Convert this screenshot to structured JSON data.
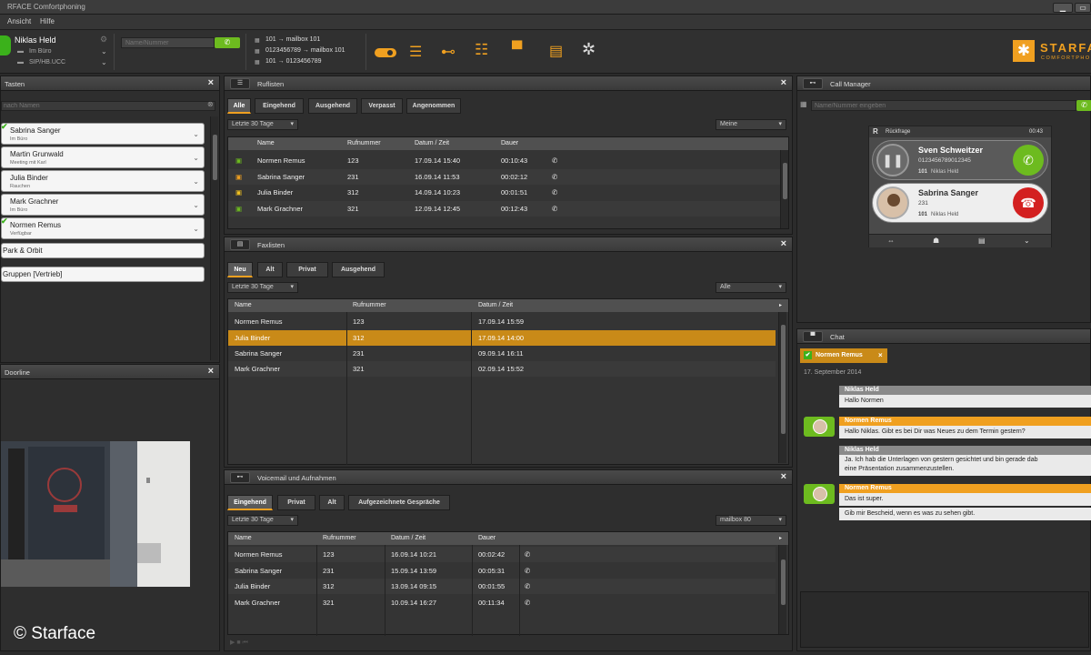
{
  "window": {
    "title": "RFACE Comfortphoning",
    "min": "▁",
    "max": "▭"
  },
  "menu": {
    "items": [
      "Ansicht",
      "Hilfe"
    ]
  },
  "user": {
    "name": "Niklas Held",
    "status": "Im Büro",
    "device": "SIP/HB.UCC"
  },
  "dial": {
    "placeholder": "Name/Nummer"
  },
  "forwards": [
    "101 → mailbox 101",
    "0123456789 → mailbox 101",
    "101 → 0123456789"
  ],
  "brand": {
    "name": "STARFA",
    "sub": "COMFORTPHO"
  },
  "tasten": {
    "title": "Tasten",
    "search_placeholder": "nach Namen",
    "keys": [
      {
        "name": "Sabrina Sanger",
        "sub": "Im Büro",
        "check": true
      },
      {
        "name": "Martin Grunwald",
        "sub": "Meeting mit Karl",
        "check": false
      },
      {
        "name": "Julia Binder",
        "sub": "Rauchen",
        "check": false
      },
      {
        "name": "Mark Grachner",
        "sub": "Im Büro",
        "check": false
      },
      {
        "name": "Normen Remus",
        "sub": "Verfügbar",
        "check": true
      }
    ],
    "groups": [
      "Park & Orbit",
      "Gruppen [Vertrieb]"
    ]
  },
  "doorline": {
    "title": "Doorline",
    "watermark": "© Starface"
  },
  "rufliste": {
    "title": "Ruflisten",
    "tabs": [
      "Alle",
      "Eingehend",
      "Ausgehend",
      "Verpasst",
      "Angenommen"
    ],
    "period": "Letzte 30 Tage",
    "filter": "Meine",
    "columns": [
      "Name",
      "Rufnummer",
      "Datum / Zeit",
      "Dauer"
    ],
    "rows": [
      {
        "name": "Normen Remus",
        "num": "123",
        "date": "17.09.14 15:40",
        "dur": "00:10:43",
        "icon": "▣"
      },
      {
        "name": "Sabrina Sanger",
        "num": "231",
        "date": "16.09.14 11:53",
        "dur": "00:02:12",
        "icon": "▣"
      },
      {
        "name": "Julia Binder",
        "num": "312",
        "date": "14.09.14 10:23",
        "dur": "00:01:51",
        "icon": "▣"
      },
      {
        "name": "Mark Grachner",
        "num": "321",
        "date": "12.09.14 12:45",
        "dur": "00:12:43",
        "icon": "▣"
      }
    ]
  },
  "fax": {
    "title": "Faxlisten",
    "tabs": [
      "Neu",
      "Alt",
      "Privat",
      "Ausgehend"
    ],
    "period": "Letzte 30 Tage",
    "filter": "Alle",
    "columns": [
      "Name",
      "Rufnummer",
      "Datum / Zeit"
    ],
    "rows": [
      {
        "name": "Normen Remus",
        "num": "123",
        "date": "17.09.14 15:59"
      },
      {
        "name": "Julia Binder",
        "num": "312",
        "date": "17.09.14 14:00"
      },
      {
        "name": "Sabrina Sanger",
        "num": "231",
        "date": "09.09.14 16:11"
      },
      {
        "name": "Mark Grachner",
        "num": "321",
        "date": "02.09.14 15:52"
      }
    ]
  },
  "voicemail": {
    "title": "Voicemail und Aufnahmen",
    "tabs": [
      "Eingehend",
      "Privat",
      "Alt",
      "Aufgezeichnete Gespräche"
    ],
    "period": "Letzte 30 Tage",
    "filter": "mailbox 80",
    "columns": [
      "Name",
      "Rufnummer",
      "Datum / Zeit",
      "Dauer"
    ],
    "rows": [
      {
        "name": "Normen Remus",
        "num": "123",
        "date": "16.09.14 10:21",
        "dur": "00:02:42"
      },
      {
        "name": "Sabrina Sanger",
        "num": "231",
        "date": "15.09.14 13:59",
        "dur": "00:05:31"
      },
      {
        "name": "Julia Binder",
        "num": "312",
        "date": "13.09.14 09:15",
        "dur": "00:01:55"
      },
      {
        "name": "Mark Grachner",
        "num": "321",
        "date": "10.09.14 16:27",
        "dur": "00:11:34"
      }
    ]
  },
  "callmanager": {
    "title": "Call Manager",
    "placeholder": "Name/Nummer eingeben",
    "header": "Rückfrage",
    "time": "00:43",
    "call1": {
      "name": "Sven Schweitzer",
      "num": "0123456789012345",
      "line": "101",
      "user": "Niklas Held"
    },
    "call2": {
      "name": "Sabrina Sanger",
      "num": "231",
      "line": "101",
      "user": "Niklas Held"
    }
  },
  "chat": {
    "title": "Chat",
    "tab": "Normen Remus",
    "date": "17. September 2014",
    "messages": [
      {
        "from": "Niklas Held",
        "lines": [
          "Hallo Normen"
        ]
      },
      {
        "from": "Normen Remus",
        "lines": [
          "Hallo Niklas. Gibt es bei Dir was Neues zu dem Termin gestern?"
        ]
      },
      {
        "from": "Niklas Held",
        "lines": [
          "Ja. Ich hab die Unterlagen von gestern gesichtet und bin gerade dab",
          "eine Präsentation zusammenzustellen."
        ]
      },
      {
        "from": "Normen Remus",
        "lines": [
          "Das ist super."
        ]
      },
      {
        "from": "",
        "lines": [
          "Gib mir Bescheid, wenn es was zu sehen gibt."
        ]
      }
    ]
  }
}
